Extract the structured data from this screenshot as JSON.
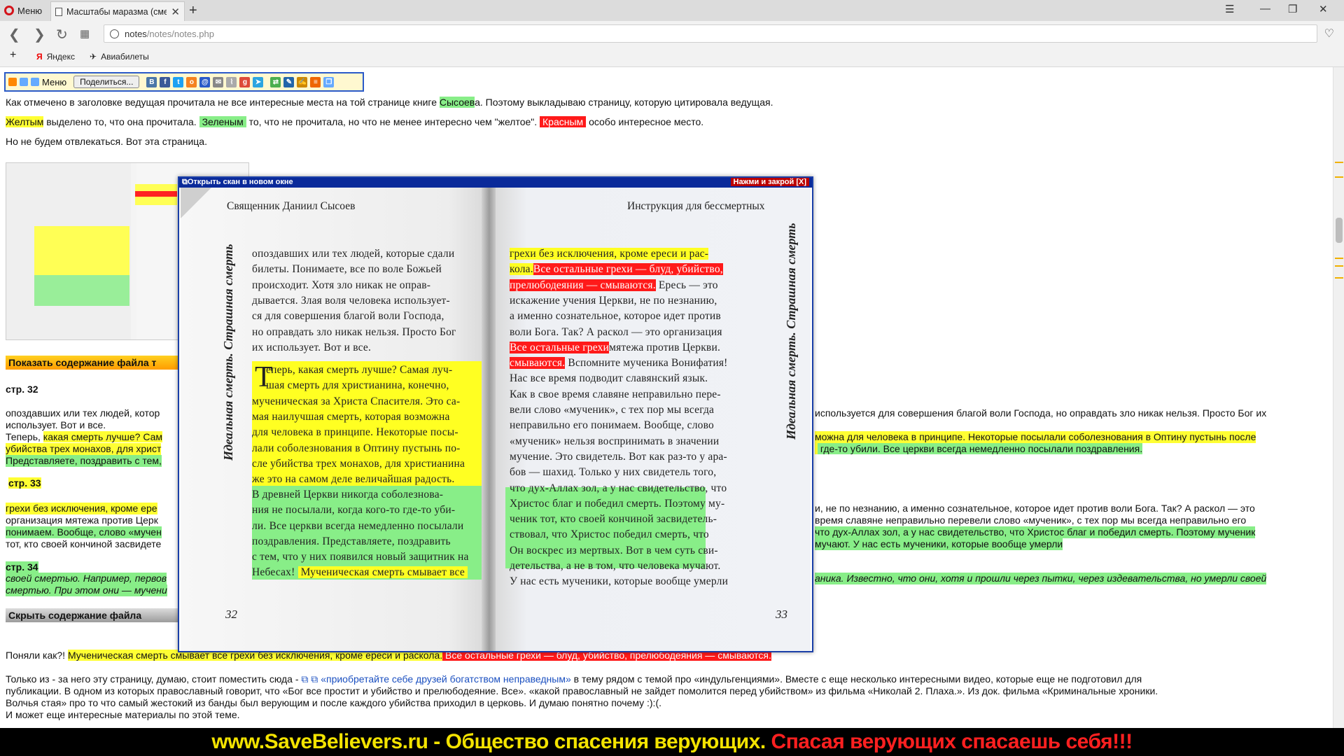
{
  "browser": {
    "menu_label": "Меню",
    "tab_title": "Масштабы маразма (сме",
    "url_host": "notes",
    "url_path": "/notes/notes.php",
    "bookmarks": [
      {
        "label": "Яндекс"
      },
      {
        "label": "Авиабилеты"
      }
    ]
  },
  "sharebar": {
    "menu_label": "Меню",
    "share_label": "Поделиться..."
  },
  "intro": {
    "line1": "Как отмечено в заголовке ведущая прочитала не все интересные места на той странице книге ",
    "line1_name": "Сысоев",
    "line1_end": "а. Поэтому выкладываю страницу, которую цитировала ведущая.",
    "legend_yellow": "Желтым",
    "legend_text1": " выделено то, что она прочитала. ",
    "legend_green": "Зеленым",
    "legend_text2": " то, что не прочитала, но что не менее интересно чем \"желтое\". ",
    "legend_red": "Красным",
    "legend_text3": " особо интересное место.",
    "line3": "Но не будем отвлекаться. Вот эта страница."
  },
  "file_toggle": {
    "show_label": "Показать содержание файла т",
    "hide_label": "Скрыть содержание файла"
  },
  "pages_text": {
    "p32_label": "стр. 32",
    "p32_l1": "опоздавших или тех людей, котор",
    "p32_l1_right": "используется для совершения благой воли Господа, но оправдать зло никак нельзя. Просто Бог их",
    "p32_l2": "использует. Вот и все.",
    "p32_l3a": "Теперь, ",
    "p32_l3b": "какая смерть лучше? Сам",
    "p32_l3_right": "можна для человека в принципе. Некоторые посылали соболезнования в Оптину пустынь после",
    "p32_l4a": "убийства трех монахов, для христ",
    "p32_l4_right": " где-то убили. Все церкви всегда немедленно посылали поздравления.",
    "p32_l5": "Представляете, поздравить с тем,",
    "p33_label": "стр. 33",
    "p33_l1": "грехи без исключения, кроме ере",
    "p33_l1_right": "и, не по незнанию, а именно сознательное, которое идет против воли Бога. Так? А раскол — это",
    "p33_l2": "организация мятежа против Церк",
    "p33_l2_right": " время славяне неправильно перевели слово «мученик», с тех пор мы всегда неправильно его",
    "p33_l3": "понимаем. Вообще, слово «мучен",
    "p33_l3_right": "что дух-Аллах зол, а у нас свидетельство, что Христос благ и победил смерть. Поэтому мученик",
    "p33_l4": "тот, кто своей кончиной засвидете",
    "p33_l4_right": "мучают. У нас есть мученики, которые вообще умерли",
    "p34_label": "стр. 34",
    "p34_l1": "своей смертью. Например, первов",
    "p34_l1_right": "аника. Известно, что они, хотя и прошли через пытки, через издевательства, но умерли своей",
    "p34_l2": "смертью. При этом они — мучени"
  },
  "conclusion": {
    "l1a": "Поняли как?! ",
    "l1b": "Мученическая смерть смывает все грехи без исключения, кроме ереси и раскола.",
    "l1c": " Все остальные грехи — блуд, убийство, прелюбодеяния — смываются.",
    "l2a": "Только из - за него эту страницу, думаю, стоит поместить сюда - ",
    "l2_link": "«приобретайте себе друзей богатством неправедным»",
    "l2b": " в тему рядом с темой про «индульгенциями». Вместе с еще несколько интересными видео, которые еще не подготовил для",
    "l3": "публикации. В одном из которых православный говорит, что «Бог все простит и убийство и прелюбодеяние. Все». «какой православный не зайдет помолится перед убийством» из фильма «Николай 2. Плаха.». Из док. фильма «Криминальные хроники.",
    "l4": "Волчья стая» про то что самый жестокий из банды был верующим и после каждого убийства приходил в церковь. И думаю понятно почему :):(.",
    "l5": "И может еще интересные материалы по этой теме."
  },
  "popup": {
    "open_label": "Открыть скан в новом окне",
    "close_label": "Нажми и закрой [X]",
    "left_header": "Священник Даниил Сысоев",
    "right_header": "Инструкция для бессмертных",
    "left_side_title": "Идеальная смерть. Страшная смерть",
    "right_side_title": "Идеальная смерть. Страшная смерть",
    "left_page_num": "32",
    "right_page_num": "33",
    "left_lines": [
      "опоздавших или тех людей, которые сдали",
      "билеты. Понимаете, все по воле Божьей",
      "происходит. Хотя зло никак не оправ-",
      "дывается. Злая воля человека использует-",
      "ся для совершения благой воли Господа,",
      "но оправдать зло никак нельзя. Просто Бог",
      "их использует. Вот и все."
    ],
    "left_yellow_lines": [
      "еперь, какая смерть лучше? Самая луч-",
      "шая смерть для христианина, конечно,",
      "мученическая за Христа Спасителя. Это са-",
      "мая наилучшая смерть, которая возможна",
      "для человека в принципе. Некоторые посы-",
      "лали соболезнования в Оптину пустынь по-",
      "сле убийства трех монахов, для христианина",
      "же это на самом деле величайшая радость."
    ],
    "dropcap": "Т",
    "left_green_lines": [
      "В древней Церкви никогда соболезнова-",
      "ния не посылали, когда кого-то где-то уби-",
      "ли. Все церкви всегда немедленно посылали",
      "поздравления. Представляете, поздравить",
      "с тем, что у них появился новый защитник на"
    ],
    "left_last_green": "Небесах!",
    "left_last_yellow": "Мученическая смерть смывает все",
    "right_lines": [
      {
        "y": "грехи без исключения, кроме ереси и рас-"
      },
      {
        "y": "кола.",
        "r": "Все остальные грехи — блуд, убийство,"
      },
      {
        "r": "прелюбодеяния — смываются.",
        "t": " Ересь — это"
      },
      {
        "t": "искажение учения Церкви, не по незнанию,"
      },
      {
        "t": "а именно сознательное, которое идет против"
      },
      {
        "t": "воли Бога. Так? А раскол — это организация"
      },
      {
        "t": "мятежа против Церкви.",
        "r": "Все остальные грехи"
      },
      {
        "r": "смываются.",
        "t": " Вспомните мученика Вонифатия!"
      },
      {
        "t": "Нас все время подводит славянский язык."
      },
      {
        "t": "Как в свое время славяне неправильно пере-"
      },
      {
        "t": "вели слово «мученик», с тех пор мы всегда"
      },
      {
        "t": "неправильно его понимаем. Вообще, слово"
      },
      {
        "t": "«мученик» нельзя воспринимать в значении"
      },
      {
        "t": "мучение. Это свидетель. Вот как раз-то у ара-"
      },
      {
        "t": "бов — шахид. Только у них свидетель того,"
      },
      {
        "t": "что дух-Аллах зол, а у нас свидетельство, что"
      },
      {
        "t": "Христос благ и победил смерть.",
        "g": " Поэтому му-"
      },
      {
        "g": "ченик тот, кто своей кончиной засвидетель-"
      },
      {
        "g": "ствовал, что Христос победил смерть, что"
      },
      {
        "g": "Он воскрес из мертвых. Вот в чем суть сви-"
      },
      {
        "g": "детельства, а не в том, что человека мучают."
      },
      {
        "g": "У нас есть мученики, которые вообще умерли"
      }
    ]
  },
  "banner": {
    "part1": "www.SaveBelievers.ru - Общество спасения верующих.",
    "part2": " Спасая верующих спасаешь себя!!!"
  },
  "colors": {
    "highlight_yellow": "#ffff33",
    "highlight_green": "#88ee88",
    "highlight_red": "#ff1a1a",
    "banner_yellow": "#f3e300",
    "banner_red": "#ff2020"
  }
}
